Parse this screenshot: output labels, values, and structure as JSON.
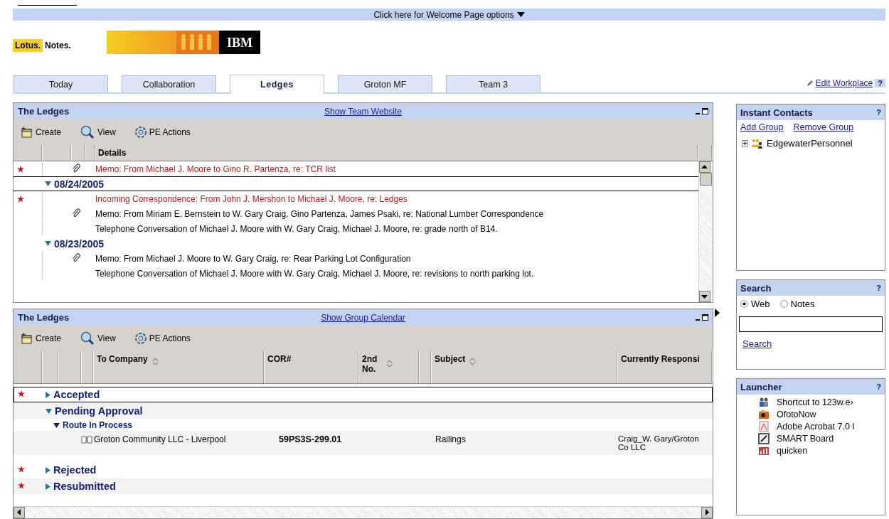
{
  "options_bar": {
    "label": "Click here for Welcome Page options"
  },
  "brand": {
    "lotus": "Lotus.",
    "notes": "Notes.",
    "ibm": "IBM"
  },
  "tabs": [
    {
      "label": "Today",
      "selected": false
    },
    {
      "label": "Collaboration",
      "selected": false
    },
    {
      "label": "Ledges",
      "selected": true
    },
    {
      "label": "Groton MF",
      "selected": false
    },
    {
      "label": "Team 3",
      "selected": false
    }
  ],
  "edit_workplace": {
    "label": "Edit Workplace",
    "help": "?"
  },
  "top_view": {
    "title": "The Ledges",
    "link": "Show Team Website",
    "toolbar": [
      {
        "kind": "create",
        "label": "Create"
      },
      {
        "kind": "view",
        "label": "View"
      },
      {
        "kind": "actions",
        "label": "PE Actions"
      }
    ],
    "columns": [
      "Details"
    ],
    "rows": [
      {
        "kind": "doc",
        "selected": false,
        "starred": true,
        "attachment": true,
        "unread": true,
        "text": "Memo: From  Michael J. Moore  to  Gino R. Partenza,  re: TCR list"
      },
      {
        "kind": "date",
        "selected": true,
        "expanded": true,
        "text": "08/24/2005"
      },
      {
        "kind": "doc",
        "selected": false,
        "starred": true,
        "attachment": false,
        "unread": true,
        "text": "Incoming Correspondence: From  John J. Mershon  to  Michael J. Moore,  re: Ledges"
      },
      {
        "kind": "doc",
        "selected": false,
        "starred": false,
        "attachment": true,
        "unread": false,
        "text": "Memo: From  Miriam E. Bernstein  to  W. Gary Craig, Gino Partenza, James Psaki,  re: National Lumber Correspondence"
      },
      {
        "kind": "doc",
        "selected": false,
        "starred": false,
        "attachment": false,
        "unread": false,
        "text": "Telephone Conversation of Michael J. Moore with W. Gary Craig, Michael J. Moore, re: grade north of B14."
      },
      {
        "kind": "date",
        "selected": false,
        "expanded": true,
        "text": "08/23/2005"
      },
      {
        "kind": "doc",
        "selected": false,
        "starred": false,
        "attachment": true,
        "unread": false,
        "text": "Memo: From  Michael J. Moore  to  W. Gary Craig,  re: Rear Parking Lot Configuration"
      },
      {
        "kind": "doc",
        "selected": false,
        "starred": false,
        "attachment": false,
        "unread": false,
        "text": "Telephone Conversation of Michael J. Moore with W. Gary Craig, Michael J. Moore, re: revisions to north parking lot."
      }
    ]
  },
  "bottom_view": {
    "title": "The Ledges",
    "link": "Show Group Calendar",
    "toolbar": [
      {
        "kind": "create",
        "label": "Create"
      },
      {
        "kind": "view",
        "label": "View"
      },
      {
        "kind": "actions",
        "label": "PE Actions"
      }
    ],
    "columns": [
      {
        "label": "To Company",
        "sortable": true
      },
      {
        "label": "COR#",
        "sortable": false
      },
      {
        "label": "2nd No.",
        "sortable": true
      },
      {
        "label": "Subject",
        "sortable": true
      },
      {
        "label": "Currently Responsi",
        "sortable": false
      }
    ],
    "rows": [
      {
        "kind": "category",
        "selected": true,
        "starred": true,
        "expanded": false,
        "text": "Accepted"
      },
      {
        "kind": "category",
        "selected": false,
        "starred": false,
        "expanded": true,
        "text": "Pending Approval"
      },
      {
        "kind": "subcategory",
        "selected": false,
        "starred": false,
        "expanded": true,
        "text": "Route In Process"
      },
      {
        "kind": "doc",
        "selected": false,
        "starred": false,
        "to_company": "Groton Community LLC - Liverpool",
        "cor": "59PS3S-299.01",
        "subject": "Railings",
        "responsible": "Craig_W. Gary/Groton Co LLC"
      },
      {
        "kind": "category",
        "selected": false,
        "starred": true,
        "expanded": false,
        "text": "Rejected"
      },
      {
        "kind": "category",
        "selected": false,
        "starred": true,
        "expanded": false,
        "text": "Resubmitted"
      }
    ]
  },
  "instant_contacts": {
    "title": "Instant Contacts",
    "help": "?",
    "links": [
      "Add Group",
      "Remove Group"
    ],
    "groups": [
      {
        "name": "EdgewaterPersonnel",
        "expanded": false
      }
    ]
  },
  "search": {
    "title": "Search",
    "help": "?",
    "options": [
      {
        "label": "Web",
        "selected": true
      },
      {
        "label": "Notes",
        "selected": false
      }
    ],
    "button": "Search"
  },
  "launcher": {
    "title": "Launcher",
    "help": "?",
    "items": [
      {
        "kind": "people",
        "label": "Shortcut to 123w.e›"
      },
      {
        "kind": "photo",
        "label": "OfotoNow"
      },
      {
        "kind": "pdf",
        "label": "Adobe Acrobat 7.0 I"
      },
      {
        "kind": "board",
        "label": "SMART Board"
      },
      {
        "kind": "money",
        "label": "quicken"
      }
    ]
  }
}
